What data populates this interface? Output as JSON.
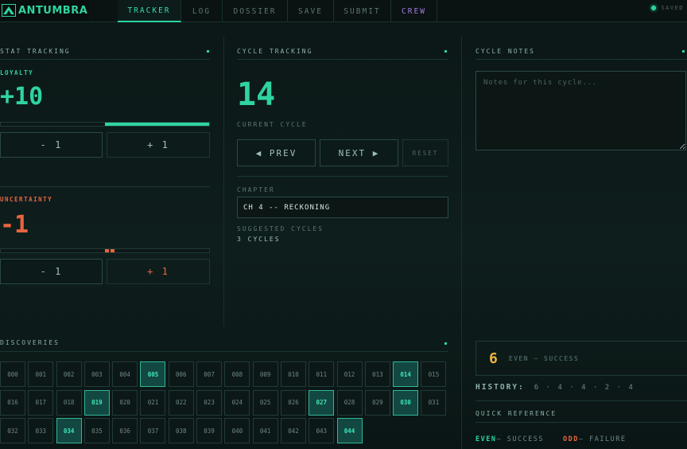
{
  "app": {
    "logo_text": "ANTUMBRA",
    "saved_label": "SAVED"
  },
  "tabs": [
    {
      "label": "TRACKER"
    },
    {
      "label": "LOG"
    },
    {
      "label": "DOSSIER"
    },
    {
      "label": "SAVE"
    },
    {
      "label": "SUBMIT"
    },
    {
      "label": "CREW"
    }
  ],
  "stats": {
    "title": "STAT TRACKING",
    "loyalty": {
      "label": "LOYALTY",
      "value": "+10",
      "minus_label": "- 1",
      "plus_label": "+ 1",
      "level_fraction": 0.5
    },
    "uncertainty": {
      "label": "UNCERTAINTY",
      "value": "-1",
      "minus_label": "- 1",
      "plus_label": "+ 1"
    }
  },
  "cycle": {
    "title": "CYCLE TRACKING",
    "value": "14",
    "caption": "CURRENT CYCLE",
    "prev_label": "◀ PREV",
    "next_label": "NEXT ▶",
    "reset_label": "RESET",
    "chapter_label": "CHAPTER",
    "chapter_value": "CH 4 -- RECKONING",
    "suggested_label": "SUGGESTED CYCLES",
    "suggested_value": "3 CYCLES"
  },
  "notes": {
    "title": "CYCLE NOTES",
    "placeholder": "Notes for this cycle..."
  },
  "discoveries": {
    "title": "DISCOVERIES",
    "cells": [
      {
        "label": "000",
        "on": false
      },
      {
        "label": "001",
        "on": false
      },
      {
        "label": "002",
        "on": false
      },
      {
        "label": "003",
        "on": false
      },
      {
        "label": "004",
        "on": false
      },
      {
        "label": "005",
        "on": true
      },
      {
        "label": "006",
        "on": false
      },
      {
        "label": "007",
        "on": false
      },
      {
        "label": "008",
        "on": false
      },
      {
        "label": "009",
        "on": false
      },
      {
        "label": "010",
        "on": false
      },
      {
        "label": "011",
        "on": false
      },
      {
        "label": "012",
        "on": false
      },
      {
        "label": "013",
        "on": false
      },
      {
        "label": "014",
        "on": true
      },
      {
        "label": "015",
        "on": false
      },
      {
        "label": "016",
        "on": false
      },
      {
        "label": "017",
        "on": false
      },
      {
        "label": "018",
        "on": false
      },
      {
        "label": "019",
        "on": true
      },
      {
        "label": "020",
        "on": false
      },
      {
        "label": "021",
        "on": false
      },
      {
        "label": "022",
        "on": false
      },
      {
        "label": "023",
        "on": false
      },
      {
        "label": "024",
        "on": false
      },
      {
        "label": "025",
        "on": false
      },
      {
        "label": "026",
        "on": false
      },
      {
        "label": "027",
        "on": true
      },
      {
        "label": "028",
        "on": false
      },
      {
        "label": "029",
        "on": false
      },
      {
        "label": "030",
        "on": true
      },
      {
        "label": "031",
        "on": false
      },
      {
        "label": "032",
        "on": false
      },
      {
        "label": "033",
        "on": false
      },
      {
        "label": "034",
        "on": true
      },
      {
        "label": "035",
        "on": false
      },
      {
        "label": "036",
        "on": false
      },
      {
        "label": "037",
        "on": false
      },
      {
        "label": "038",
        "on": false
      },
      {
        "label": "039",
        "on": false
      },
      {
        "label": "040",
        "on": false
      },
      {
        "label": "041",
        "on": false
      },
      {
        "label": "042",
        "on": false
      },
      {
        "label": "043",
        "on": false
      },
      {
        "label": "044",
        "on": true
      }
    ]
  },
  "outcome": {
    "value": "6",
    "text": "EVEN – SUCCESS"
  },
  "history": {
    "label": "HISTORY:",
    "values": "6 · 4 · 4 · 2 · 4"
  },
  "quick_ref": {
    "title": "QUICK REFERENCE",
    "even_key": "EVEN",
    "even_text": " – SUCCESS",
    "odd_key": "ODD",
    "odd_text": " – FAILURE"
  },
  "colors": {
    "accent": "#2fd3a1",
    "danger": "#e8653f",
    "gold": "#f0b341",
    "crew": "#a17be0"
  }
}
